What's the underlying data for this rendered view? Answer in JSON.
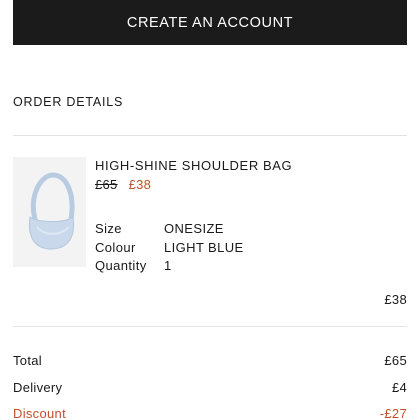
{
  "create_account": {
    "label": "CREATE AN ACCOUNT"
  },
  "order_details": {
    "title": "ORDER DETAILS",
    "item": {
      "name": "HIGH-SHINE SHOULDER BAG",
      "original_price": "£65",
      "sale_price": "£38",
      "attributes": [
        {
          "label": "Size",
          "value": "ONESIZE"
        },
        {
          "label": "Colour",
          "value": "LIGHT BLUE"
        },
        {
          "label": "Quantity",
          "value": "1"
        }
      ],
      "line_total": "£38",
      "image_color": "#c9d8ea"
    }
  },
  "summary": {
    "total": {
      "label": "Total",
      "value": "£65"
    },
    "delivery": {
      "label": "Delivery",
      "value": "£4"
    },
    "discount": {
      "label": "Discount",
      "value": "-£27"
    }
  },
  "colors": {
    "button_bg": "#1b1b1b",
    "sale_accent": "#c0502b"
  }
}
